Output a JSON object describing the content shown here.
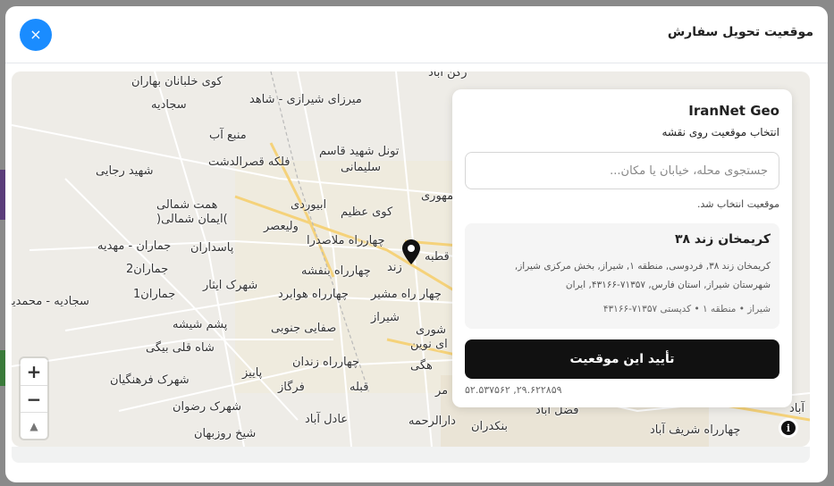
{
  "modal": {
    "title": "موقعیت تحویل سفارش",
    "close_glyph": "×"
  },
  "map": {
    "zoom_in": "+",
    "zoom_out": "−",
    "compass": "▲",
    "info_glyph": "i",
    "labels": [
      {
        "text": "کوی خلبانان بهاران"
      },
      {
        "text": "سجادیه"
      },
      {
        "text": "میرزای شیرازی - شاهد"
      },
      {
        "text": "رکن آباد"
      },
      {
        "text": "منبع آب"
      },
      {
        "text": "فلکه قصرالدشت"
      },
      {
        "text": "تونل شهید قاسم"
      },
      {
        "text": "سلیمانی"
      },
      {
        "text": "شهید رجایی"
      },
      {
        "text": "همت شمالی"
      },
      {
        "text": ")ایمان شمالی("
      },
      {
        "text": "ابیوردی"
      },
      {
        "text": "کوی عظیم"
      },
      {
        "text": "جمهوری"
      },
      {
        "text": "ولیعصر"
      },
      {
        "text": "چهارراه ملاصدرا"
      },
      {
        "text": "جماران - مهدیه"
      },
      {
        "text": "پاسداران"
      },
      {
        "text": "زند"
      },
      {
        "text": "قطبه"
      },
      {
        "text": "جماران2"
      },
      {
        "text": "چهارراه بنفشه"
      },
      {
        "text": "شهرک ایثار"
      },
      {
        "text": "سجادیه - محمدیه"
      },
      {
        "text": "جماران1"
      },
      {
        "text": "چهارراه هوابرد"
      },
      {
        "text": "چهار راه مشیر"
      },
      {
        "text": "شیراز"
      },
      {
        "text": "پشم شیشه"
      },
      {
        "text": "صفایی جنوبی"
      },
      {
        "text": "شوری"
      },
      {
        "text": "ای نوین"
      },
      {
        "text": "شاه قلی بیگی"
      },
      {
        "text": "چهارراه زندان"
      },
      {
        "text": "پاییز"
      },
      {
        "text": "هگی"
      },
      {
        "text": "شهرک فرهنگیان"
      },
      {
        "text": "فرگاز"
      },
      {
        "text": "قبله"
      },
      {
        "text": "مر"
      },
      {
        "text": "شهرک رضوان"
      },
      {
        "text": "عادل آباد"
      },
      {
        "text": "دارالرحمه"
      },
      {
        "text": "فضل آباد"
      },
      {
        "text": "بنکدران"
      },
      {
        "text": "چهارراه شریف آباد"
      },
      {
        "text": "آباد"
      },
      {
        "text": "شیخ روزبهان"
      }
    ]
  },
  "panel": {
    "brand": "IranNet Geo",
    "subtitle": "انتخاب موقعیت روی نقشه",
    "search_placeholder": "جستجوی محله، خیابان یا مکان...",
    "search_value": "",
    "status": "موقعیت انتخاب شد.",
    "address": {
      "title": "کریمخان زند ۳۸",
      "full": "کریمخان زند ۳۸, فردوسی, منطقه ۱, شیراز, بخش مرکزی شیراز, شهرستان شیراز, استان فارس, ۷۱۳۵۷-۴۳۱۶۶, ایران",
      "meta": "شیراز • منطقه ۱ • کدپستی ۷۱۳۵۷-۴۳۱۶۶"
    },
    "confirm_label": "تأیید این موقعیت",
    "coordinates": "۲۹.۶۲۲۸۵۹, ۵۲.۵۳۷۵۶۲"
  },
  "colors": {
    "accent": "#1a8cff",
    "confirm_bg": "#111111",
    "map_bg": "#eeece7"
  }
}
